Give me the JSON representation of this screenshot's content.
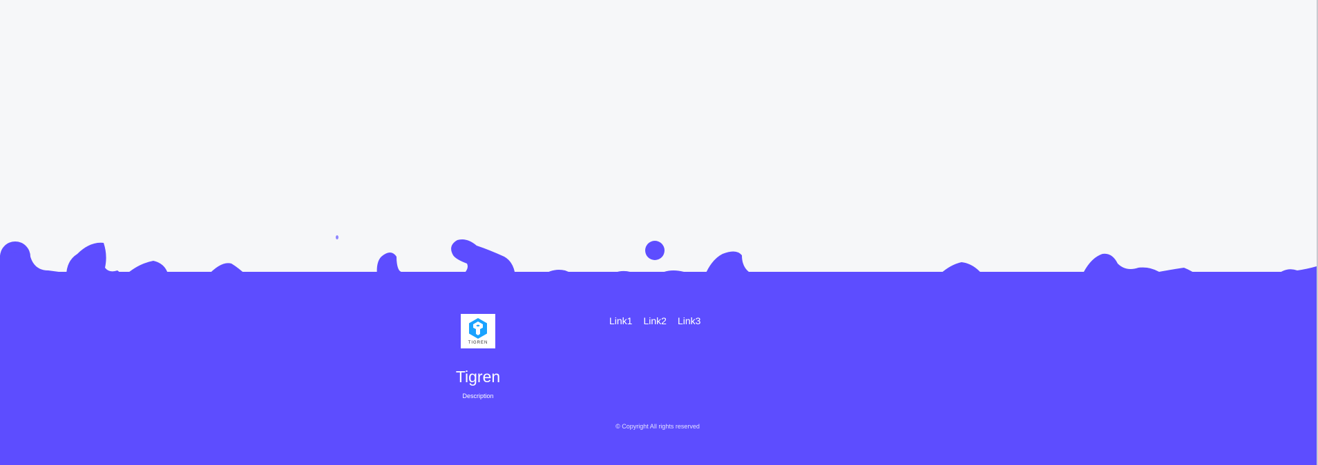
{
  "colors": {
    "page_background": "#f6f7f9",
    "footer_background": "#5d4dff",
    "text": "#ffffff",
    "logo_primary": "#1aa3ff"
  },
  "footer": {
    "logo": {
      "icon": "tigren-hexagon-logo-icon",
      "label": "TIGREN"
    },
    "brand_name": "Tigren",
    "description": "Description",
    "links": [
      {
        "label": "Link1"
      },
      {
        "label": "Link2"
      },
      {
        "label": "Link3"
      }
    ],
    "copyright": "© Copyright All rights reserved"
  }
}
